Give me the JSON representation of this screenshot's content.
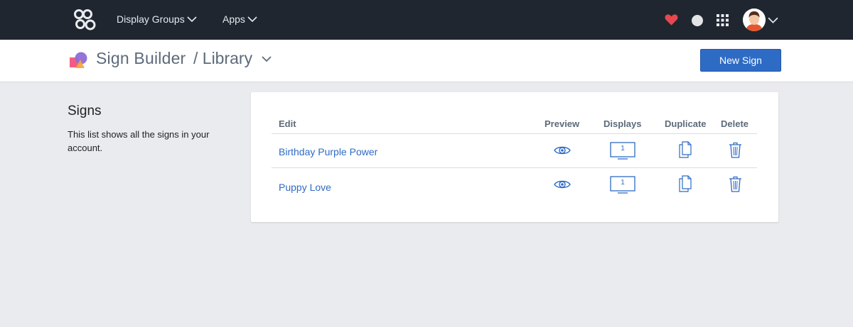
{
  "topbar": {
    "nav": [
      {
        "label": "Display Groups",
        "icon": "chevron-down-icon"
      },
      {
        "label": "Apps",
        "icon": "chevron-down-icon"
      }
    ],
    "icons": [
      "logo-icon",
      "heart-icon",
      "status-dot-icon",
      "app-grid-icon",
      "avatar",
      "chevron-down-icon"
    ],
    "heart_color": "#e8474e",
    "background": "#1f2630"
  },
  "subheader": {
    "app_title": "Sign Builder",
    "breadcrumb": "/ Library",
    "new_sign_label": "New Sign",
    "accent": "#2e6bc4"
  },
  "sidebar": {
    "title": "Signs",
    "description": "This list shows all the signs in your account."
  },
  "table": {
    "columns": [
      "Edit",
      "Preview",
      "Displays",
      "Duplicate",
      "Delete"
    ],
    "rows": [
      {
        "name": "Birthday Purple Power",
        "displays": "1"
      },
      {
        "name": "Puppy Love",
        "displays": "1"
      }
    ]
  }
}
